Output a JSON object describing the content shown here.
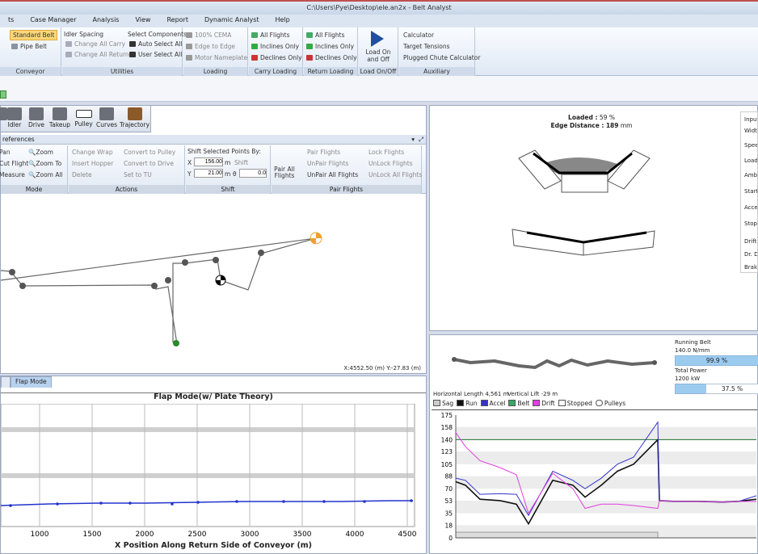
{
  "title": "C:\\Users\\Pye\\Desktop\\ele.an2x - Belt Analyst",
  "menu": [
    "ts",
    "Case Manager",
    "Analysis",
    "View",
    "Report",
    "Dynamic Analyst",
    "Help"
  ],
  "ribbon": {
    "conveyor": {
      "label": "Conveyor",
      "std": "Standard Belt",
      "pipe": "Pipe Belt"
    },
    "utilities": {
      "label": "Utilities",
      "idler_spacing": "Idler Spacing",
      "change_carry": "Change All Carry",
      "change_return": "Change All Return",
      "select_components": "Select Components",
      "auto_select": "Auto Select All",
      "user_select": "User Select All"
    },
    "loading": {
      "label": "Loading",
      "cema": "100% CEMA",
      "edge": "Edge to Edge",
      "motor": "Motor Nameplate"
    },
    "carry": {
      "label": "Carry Loading",
      "all": "All Flights",
      "inclines": "Inclines Only",
      "declines": "Declines Only"
    },
    "return": {
      "label": "Return Loading",
      "all": "All Flights",
      "inclines": "Inclines Only",
      "declines": "Declines Only"
    },
    "loadonoff": {
      "label": "Load On/Off",
      "button": "Load On and Off"
    },
    "aux": {
      "label": "Auxiliary",
      "calc": "Calculator",
      "target": "Target Tensions",
      "plugged": "Plugged Chute Calculator"
    }
  },
  "tools": [
    "Idler",
    "Drive",
    "Takeup",
    "Pulley",
    "Curves",
    "Trajectory"
  ],
  "pref": "references",
  "sub": {
    "mode": {
      "label": "Mode",
      "pan": "Pan",
      "cut": "Cut Flight",
      "measure": "Measure",
      "zoom": "Zoom",
      "zoomto": "Zoom To",
      "zoomall": "Zoom All"
    },
    "actions": {
      "label": "Actions",
      "change_wrap": "Change Wrap",
      "insert_hopper": "Insert Hopper",
      "delete": "Delete",
      "to_pulley": "Convert to Pulley",
      "to_drive": "Convert to Drive",
      "set_tu": "Set to TU"
    },
    "shift": {
      "label": "Shift",
      "title": "Shift Selected Points By:",
      "x_label": "X",
      "x_val": "156.00",
      "x_unit": "m",
      "y_label": "Y",
      "y_val": "21.00",
      "y_unit": "m",
      "theta": "θ",
      "theta_val": "0.0",
      "shift_btn": "Shift"
    },
    "pair": {
      "label": "Pair Flights",
      "pairall": "Pair All Flights",
      "pair": "Pair Flights",
      "unpair": "UnPair Flights",
      "unpairall": "UnPair All Flights",
      "lock": "Lock Flights",
      "unlock": "UnLock Flights",
      "unlockall": "UnLock All Flights"
    }
  },
  "coord": "X:4552.50 (m) Y:-27.83 (m)",
  "tabs": [
    "",
    "Flap Mode"
  ],
  "flap": {
    "title": "Flap Mode(w/ Plate Theory)",
    "xlabel": "X Position Along Return Side of Conveyor (m)",
    "xticks": [
      "1000",
      "1500",
      "2000",
      "2500",
      "3000",
      "3500",
      "4000",
      "4500"
    ]
  },
  "cross": {
    "loaded": "Loaded :",
    "loaded_val": "59",
    "loaded_unit": "%",
    "edge": "Edge Distance :",
    "edge_val": "189",
    "edge_unit": "mm",
    "side": [
      "Input",
      "Width",
      "Speed",
      "Load",
      "Ambi",
      "Startin",
      "Accel",
      "Stopp",
      "Drift",
      "Dr. D",
      "Brake"
    ]
  },
  "status": {
    "running": "Running Belt",
    "running_val": "140.0 N/mm",
    "running_pct": "99.9 %",
    "power": "Total Power",
    "power_val": "1200 kW",
    "power_pct": "37.5 %",
    "hlen": "Horizontal Length 4,561 m",
    "vlift": "Vertical Lift -29 m"
  },
  "legend": [
    "Sag",
    "Run",
    "Accel",
    "Belt",
    "Drift",
    "Stopped",
    "Pulleys"
  ],
  "colors": {
    "run": "#111111",
    "accel": "#3333cc",
    "drift": "#e040e0",
    "flap": "#2233cc",
    "threshold": "#1a6e2a"
  },
  "chart_data": {
    "type": "line",
    "ylim": [
      0,
      175
    ],
    "yticks": [
      "175",
      "158",
      "140",
      "123",
      "105",
      "88",
      "70",
      "53",
      "35",
      "18",
      "0"
    ],
    "series": [
      {
        "name": "Run",
        "values": [
          80,
          75,
          55,
          53,
          48,
          20,
          82,
          75,
          58,
          75,
          95,
          105,
          140,
          53,
          52,
          52,
          51,
          52,
          55
        ]
      },
      {
        "name": "Accel",
        "values": [
          85,
          82,
          62,
          63,
          62,
          32,
          95,
          82,
          70,
          85,
          105,
          115,
          165,
          53,
          52,
          52,
          51,
          52,
          60
        ]
      },
      {
        "name": "Drift",
        "values": [
          150,
          130,
          110,
          100,
          90,
          35,
          92,
          70,
          42,
          48,
          48,
          46,
          42,
          53,
          52,
          52,
          51,
          52,
          52
        ]
      }
    ]
  }
}
